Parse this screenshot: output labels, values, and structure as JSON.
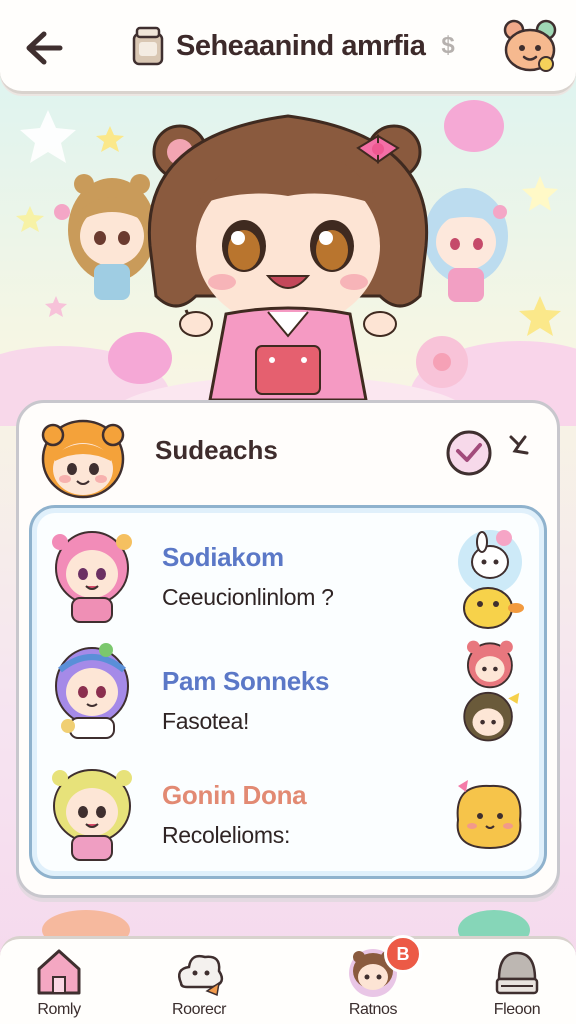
{
  "header": {
    "title": "Seheaanind amrfia",
    "title_suffix": "$",
    "back_icon": "arrow-left-icon",
    "title_icon": "jar-icon",
    "avatar_icon": "bear-avatar-icon"
  },
  "card": {
    "title": "Sudeachs",
    "check_icon": "heart-check-icon",
    "sparkle_icon": "sparkle-icon"
  },
  "list": {
    "items": [
      {
        "name": "Sodiakom",
        "subtitle": "Ceeucionlinlom ?",
        "name_color": "#5b78c7"
      },
      {
        "name": "Pam Sonneks",
        "subtitle": "Fasotea!",
        "name_color": "#5b78c7"
      },
      {
        "name": "Gonin Dona",
        "subtitle": "Recolelioms:",
        "name_color": "#e28a73"
      }
    ]
  },
  "nav": {
    "items": [
      {
        "label": "Romly",
        "icon": "home-icon"
      },
      {
        "label": "Roorecr",
        "icon": "cloud-pet-icon"
      },
      {
        "label": "Ratnos",
        "icon": "bear-girl-icon",
        "badge": "B"
      },
      {
        "label": "Fleoon",
        "icon": "bell-jar-icon"
      }
    ]
  },
  "colors": {
    "accent_blue": "#5b78c7",
    "accent_orange": "#e28a73",
    "badge": "#ec5a46",
    "list_border": "#8fb2cd"
  }
}
